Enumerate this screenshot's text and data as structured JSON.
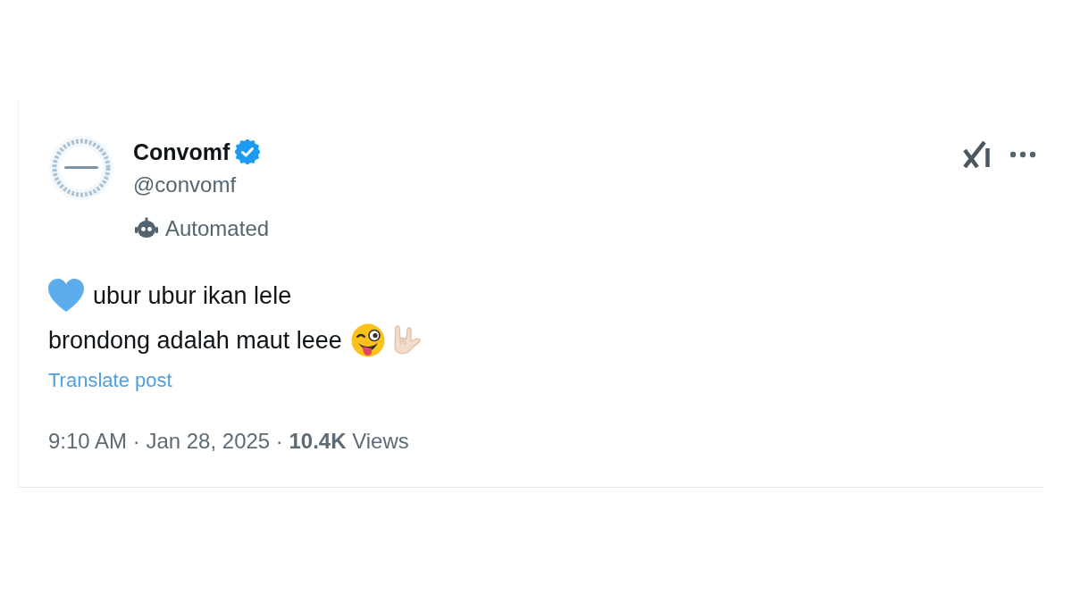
{
  "post": {
    "author": {
      "name": "Convomf",
      "verified": true,
      "handle": "@convomf",
      "label": "Automated"
    },
    "body": {
      "lines": [
        {
          "kind": "leading-heart",
          "text": "ubur ubur ikan lele"
        },
        {
          "kind": "trailing-emoji",
          "text": "brondong adalah maut leee"
        }
      ]
    },
    "translate_link": "Translate post",
    "meta": "9:10 AM · Jan 28, 2025 · **10.4K** Views"
  }
}
